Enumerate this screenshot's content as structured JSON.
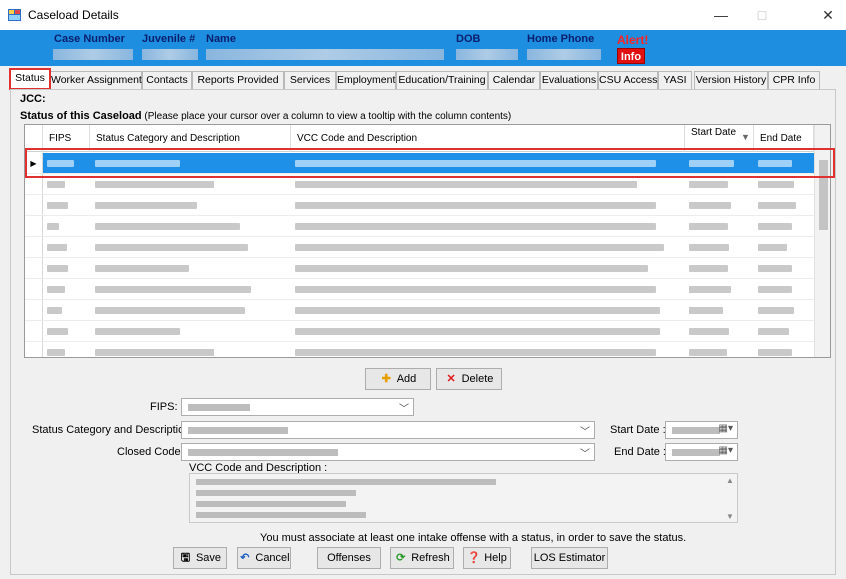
{
  "window": {
    "title": "Caseload Details",
    "minimize": "—",
    "maximize": "□",
    "close": "✕"
  },
  "header": {
    "case_number_label": "Case Number",
    "juvenile_label": "Juvenile #",
    "name_label": "Name",
    "dob_label": "DOB",
    "home_phone_label": "Home Phone",
    "alert_label": "Alert!",
    "info_button": "Info"
  },
  "tabs": [
    {
      "label": "Status"
    },
    {
      "label": "Worker Assignment"
    },
    {
      "label": "Contacts"
    },
    {
      "label": "Reports Provided"
    },
    {
      "label": "Services"
    },
    {
      "label": "Employment"
    },
    {
      "label": "Education/Training"
    },
    {
      "label": "Calendar"
    },
    {
      "label": "Evaluations"
    },
    {
      "label": "CSU Access"
    },
    {
      "label": "YASI"
    },
    {
      "label": "Version History"
    },
    {
      "label": "CPR Info"
    }
  ],
  "jcc_label": "JCC:",
  "status_section": {
    "title": "Status of this Caseload",
    "subtitle": "(Please place your cursor over a column to view a tooltip with the column contents)"
  },
  "grid": {
    "columns": [
      "FIPS",
      "Status Category and Description",
      "VCC Code and Description",
      "Start Date",
      "End Date"
    ],
    "row_count": 11,
    "selected_row": 0,
    "row_selector_glyph": "▶"
  },
  "buttons": {
    "add": "Add",
    "delete": "Delete"
  },
  "form": {
    "fips_label": "FIPS:",
    "status_category_label": "Status Category and Description:",
    "closed_code_label": "Closed Code:",
    "start_date_label": "Start Date :",
    "end_date_label": "End Date :",
    "vcc_label": "VCC Code and Description :"
  },
  "notice": "You must associate at least one intake offense with a status, in order to save the status.",
  "bottom_buttons": {
    "save": "Save",
    "cancel": "Cancel",
    "offenses": "Offenses",
    "refresh": "Refresh",
    "help": "Help",
    "los": "LOS Estimator"
  },
  "colors": {
    "header_bg": "#1e8fe0",
    "selected_row": "#1e90e8",
    "highlight_box": "#e03030",
    "alert": "#ff2222"
  }
}
